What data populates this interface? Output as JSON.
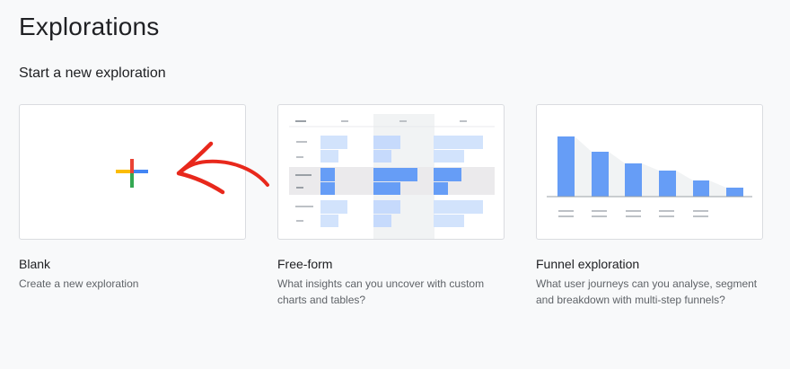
{
  "page": {
    "title": "Explorations",
    "section_title": "Start a new exploration"
  },
  "cards": [
    {
      "id": "blank",
      "label": "Blank",
      "description": "Create a new exploration",
      "icon": "plus-icon"
    },
    {
      "id": "freeform",
      "label": "Free-form",
      "description": "What insights can you uncover with custom charts and tables?",
      "icon": "table-preview"
    },
    {
      "id": "funnel",
      "label": "Funnel exploration",
      "description": "What user journeys can you analyse, segment and breakdown with multi-step funnels?",
      "icon": "funnel-preview"
    }
  ],
  "colors": {
    "blue": "#4285f4",
    "red": "#ea4335",
    "yellow": "#fbbc04",
    "green": "#34a853",
    "light_blue": "#aecbfa",
    "annotation_red": "#e8281c"
  }
}
